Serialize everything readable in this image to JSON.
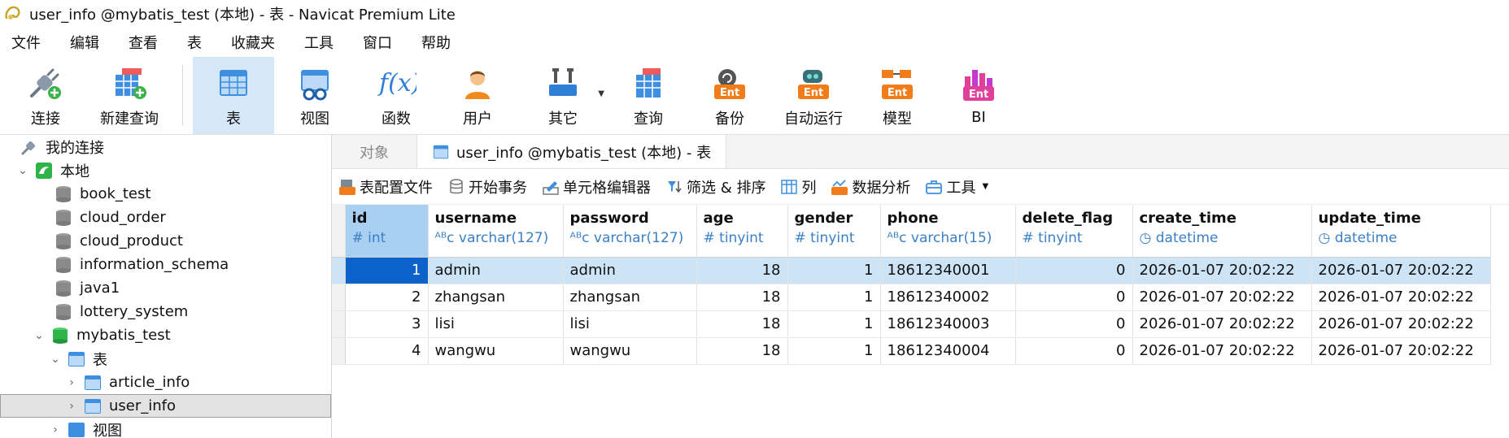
{
  "window": {
    "title": "user_info @mybatis_test (本地) - 表 - Navicat Premium Lite"
  },
  "menu": [
    "文件",
    "编辑",
    "查看",
    "表",
    "收藏夹",
    "工具",
    "窗口",
    "帮助"
  ],
  "toolbar": {
    "connect": "连接",
    "new_query": "新建查询",
    "table": "表",
    "view": "视图",
    "function": "函数",
    "user": "用户",
    "other": "其它",
    "query": "查询",
    "backup": "备份",
    "auto_run": "自动运行",
    "model": "模型",
    "bi": "BI",
    "ent_badge": "Ent",
    "fx": "f(x)"
  },
  "nav": {
    "my_connections": "我的连接",
    "local": "本地",
    "databases": [
      "book_test",
      "cloud_order",
      "cloud_product",
      "information_schema",
      "java1",
      "lottery_system"
    ],
    "open_db": "mybatis_test",
    "tables_node": "表",
    "tables": [
      "article_info",
      "user_info"
    ],
    "next_node_partial": "视图"
  },
  "tabs": {
    "objects": "对象",
    "active": "user_info @mybatis_test (本地) - 表"
  },
  "subtoolbar": {
    "table_config": "表配置文件",
    "begin_tx": "开始事务",
    "cell_editor": "单元格编辑器",
    "filter_sort": "筛选 & 排序",
    "columns": "列",
    "data_analysis": "数据分析",
    "tools": "工具"
  },
  "grid": {
    "columns": [
      {
        "name": "id",
        "type": "int",
        "type_icon": "#"
      },
      {
        "name": "username",
        "type": "varchar(127)",
        "type_icon": "ABC"
      },
      {
        "name": "password",
        "type": "varchar(127)",
        "type_icon": "ABC"
      },
      {
        "name": "age",
        "type": "tinyint",
        "type_icon": "#"
      },
      {
        "name": "gender",
        "type": "tinyint",
        "type_icon": "#"
      },
      {
        "name": "phone",
        "type": "varchar(15)",
        "type_icon": "ABC"
      },
      {
        "name": "delete_flag",
        "type": "tinyint",
        "type_icon": "#"
      },
      {
        "name": "create_time",
        "type": "datetime",
        "type_icon": "clock"
      },
      {
        "name": "update_time",
        "type": "datetime",
        "type_icon": "clock"
      }
    ],
    "rows": [
      [
        "1",
        "admin",
        "admin",
        "18",
        "1",
        "18612340001",
        "0",
        "2026-01-07 20:02:22",
        "2026-01-07 20:02:22"
      ],
      [
        "2",
        "zhangsan",
        "zhangsan",
        "18",
        "1",
        "18612340002",
        "0",
        "2026-01-07 20:02:22",
        "2026-01-07 20:02:22"
      ],
      [
        "3",
        "lisi",
        "lisi",
        "18",
        "1",
        "18612340003",
        "0",
        "2026-01-07 20:02:22",
        "2026-01-07 20:02:22"
      ],
      [
        "4",
        "wangwu",
        "wangwu",
        "18",
        "1",
        "18612340004",
        "0",
        "2026-01-07 20:02:22",
        "2026-01-07 20:02:22"
      ]
    ]
  },
  "colors": {
    "accent": "#0b63c9",
    "selection": "#cde4f7",
    "active_tool": "#d6e8f7",
    "type_text": "#3a7fc6",
    "ent_orange": "#f07d1a"
  }
}
